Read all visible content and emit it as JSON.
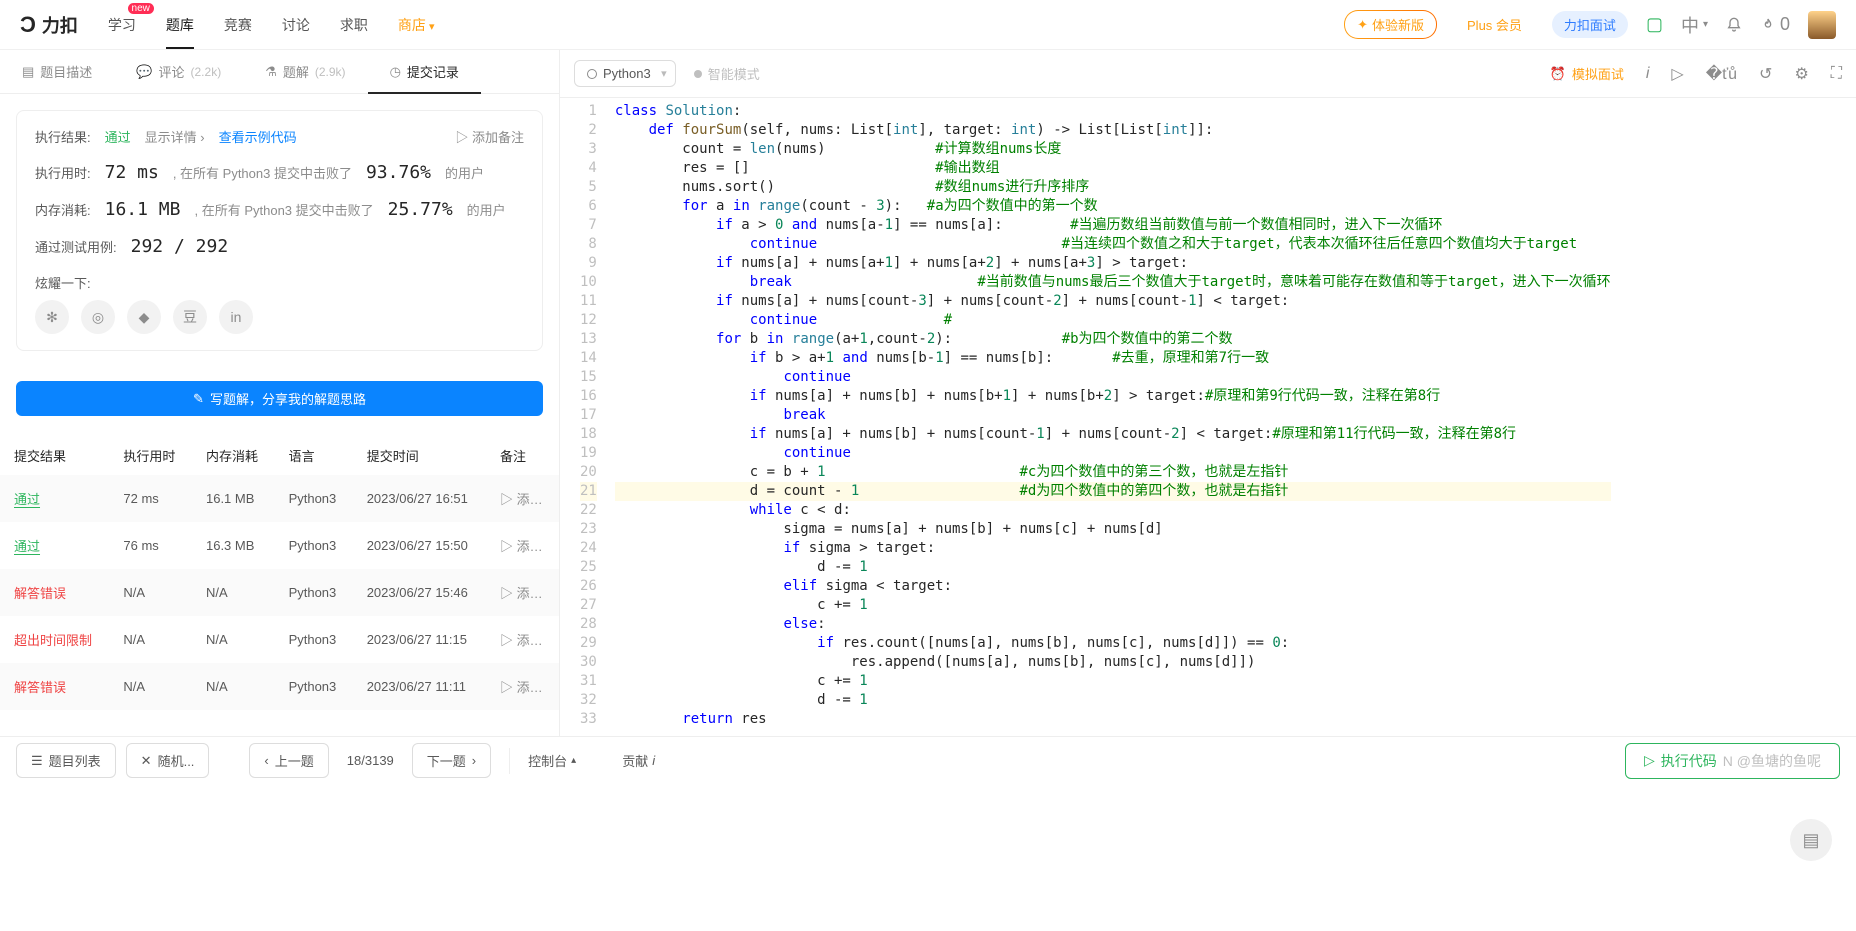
{
  "brand": "力扣",
  "nav": {
    "items": [
      {
        "label": "学习",
        "active": false,
        "highlight": false,
        "badge": "new"
      },
      {
        "label": "题库",
        "active": true
      },
      {
        "label": "竞赛"
      },
      {
        "label": "讨论"
      },
      {
        "label": "求职"
      },
      {
        "label": "商店",
        "highlight": true,
        "caret": true
      }
    ],
    "right": {
      "try_new": "体验新版",
      "plus": "Plus 会员",
      "interview": "力扣面试",
      "locale": "中",
      "fire_count": "0"
    }
  },
  "left_tabs": [
    {
      "icon": "doc",
      "label": "题目描述"
    },
    {
      "icon": "chat",
      "label": "评论",
      "count": "(2.2k)"
    },
    {
      "icon": "flask",
      "label": "题解",
      "count": "(2.9k)"
    },
    {
      "icon": "clock",
      "label": "提交记录",
      "active": true
    }
  ],
  "result": {
    "heading": "执行结果:",
    "status": "通过",
    "detail_link": "显示详情 ›",
    "example_link": "查看示例代码",
    "add_note": "添加备注",
    "time_label": "执行用时:",
    "time_value": "72 ms",
    "time_suffix_a": ", 在所有 Python3 提交中击败了",
    "time_pct": "93.76%",
    "time_suffix_b": "的用户",
    "memory_label": "内存消耗:",
    "memory_value": "16.1 MB",
    "memory_suffix_a": ", 在所有 Python3 提交中击败了",
    "memory_pct": "25.77%",
    "memory_suffix_b": "的用户",
    "tests_label": "通过测试用例:",
    "tests_value": "292 / 292",
    "brag_label": "炫耀一下:",
    "write_solution": "写题解，分享我的解题思路"
  },
  "history": {
    "headers": {
      "result": "提交结果",
      "time": "执行用时",
      "memory": "内存消耗",
      "lang": "语言",
      "submitted": "提交时间",
      "note": "备注"
    },
    "note_action": "添…",
    "rows": [
      {
        "status": "通过",
        "cls": "st-pass",
        "time": "72 ms",
        "memory": "16.1 MB",
        "lang": "Python3",
        "submitted": "2023/06/27 16:51"
      },
      {
        "status": "通过",
        "cls": "st-pass",
        "time": "76 ms",
        "memory": "16.3 MB",
        "lang": "Python3",
        "submitted": "2023/06/27 15:50"
      },
      {
        "status": "解答错误",
        "cls": "st-err",
        "time": "N/A",
        "memory": "N/A",
        "lang": "Python3",
        "submitted": "2023/06/27 15:46"
      },
      {
        "status": "超出时间限制",
        "cls": "st-err",
        "time": "N/A",
        "memory": "N/A",
        "lang": "Python3",
        "submitted": "2023/06/27 11:15"
      },
      {
        "status": "解答错误",
        "cls": "st-err",
        "time": "N/A",
        "memory": "N/A",
        "lang": "Python3",
        "submitted": "2023/06/27 11:11"
      }
    ]
  },
  "editor": {
    "language": "Python3",
    "ai_mode": "智能模式",
    "mock_label": "模拟面试",
    "code_lines": [
      {
        "n": 1,
        "segs": [
          {
            "t": "class ",
            "c": "kw"
          },
          {
            "t": "Solution",
            "c": "cls"
          },
          {
            "t": ":"
          }
        ]
      },
      {
        "n": 2,
        "segs": [
          {
            "t": "    "
          },
          {
            "t": "def ",
            "c": "kw"
          },
          {
            "t": "fourSum",
            "c": "def"
          },
          {
            "t": "(self, nums: List["
          },
          {
            "t": "int",
            "c": "builtin"
          },
          {
            "t": "], target: "
          },
          {
            "t": "int",
            "c": "builtin"
          },
          {
            "t": ") -> List[List["
          },
          {
            "t": "int",
            "c": "builtin"
          },
          {
            "t": "]]:"
          }
        ]
      },
      {
        "n": 3,
        "segs": [
          {
            "t": "        count = "
          },
          {
            "t": "len",
            "c": "builtin"
          },
          {
            "t": "(nums)             "
          },
          {
            "t": "#计算数组nums长度",
            "c": "cmt"
          }
        ]
      },
      {
        "n": 4,
        "segs": [
          {
            "t": "        res = []                      "
          },
          {
            "t": "#输出数组",
            "c": "cmt"
          }
        ]
      },
      {
        "n": 5,
        "segs": [
          {
            "t": "        nums.sort()                   "
          },
          {
            "t": "#数组nums进行升序排序",
            "c": "cmt"
          }
        ]
      },
      {
        "n": 6,
        "segs": [
          {
            "t": "        "
          },
          {
            "t": "for",
            "c": "kw"
          },
          {
            "t": " a "
          },
          {
            "t": "in",
            "c": "kw"
          },
          {
            "t": " "
          },
          {
            "t": "range",
            "c": "builtin"
          },
          {
            "t": "(count - "
          },
          {
            "t": "3",
            "c": "num"
          },
          {
            "t": "):   "
          },
          {
            "t": "#a为四个数值中的第一个数",
            "c": "cmt"
          }
        ]
      },
      {
        "n": 7,
        "segs": [
          {
            "t": "            "
          },
          {
            "t": "if",
            "c": "kw"
          },
          {
            "t": " a > "
          },
          {
            "t": "0",
            "c": "num"
          },
          {
            "t": " "
          },
          {
            "t": "and",
            "c": "kw"
          },
          {
            "t": " nums[a-"
          },
          {
            "t": "1",
            "c": "num"
          },
          {
            "t": "] == nums[a]:        "
          },
          {
            "t": "#当遍历数组当前数值与前一个数值相同时，进入下一次循环",
            "c": "cmt"
          }
        ]
      },
      {
        "n": 8,
        "segs": [
          {
            "t": "                "
          },
          {
            "t": "continue",
            "c": "kw"
          },
          {
            "t": "                             "
          },
          {
            "t": "#当连续四个数值之和大于target，代表本次循环往后任意四个数值均大于target",
            "c": "cmt"
          }
        ]
      },
      {
        "n": 9,
        "segs": [
          {
            "t": "            "
          },
          {
            "t": "if",
            "c": "kw"
          },
          {
            "t": " nums[a] + nums[a+"
          },
          {
            "t": "1",
            "c": "num"
          },
          {
            "t": "] + nums[a+"
          },
          {
            "t": "2",
            "c": "num"
          },
          {
            "t": "] + nums[a+"
          },
          {
            "t": "3",
            "c": "num"
          },
          {
            "t": "] > target:"
          }
        ]
      },
      {
        "n": 10,
        "segs": [
          {
            "t": "                "
          },
          {
            "t": "break",
            "c": "kw"
          },
          {
            "t": "                      "
          },
          {
            "t": "#当前数值与nums最后三个数值大于target时，意味着可能存在数值和等于target，进入下一次循环",
            "c": "cmt"
          }
        ]
      },
      {
        "n": 11,
        "segs": [
          {
            "t": "            "
          },
          {
            "t": "if",
            "c": "kw"
          },
          {
            "t": " nums[a] + nums[count-"
          },
          {
            "t": "3",
            "c": "num"
          },
          {
            "t": "] + nums[count-"
          },
          {
            "t": "2",
            "c": "num"
          },
          {
            "t": "] + nums[count-"
          },
          {
            "t": "1",
            "c": "num"
          },
          {
            "t": "] < target:"
          }
        ]
      },
      {
        "n": 12,
        "segs": [
          {
            "t": "                "
          },
          {
            "t": "continue",
            "c": "kw"
          },
          {
            "t": "               "
          },
          {
            "t": "#",
            "c": "cmt"
          }
        ]
      },
      {
        "n": 13,
        "segs": [
          {
            "t": "            "
          },
          {
            "t": "for",
            "c": "kw"
          },
          {
            "t": " b "
          },
          {
            "t": "in",
            "c": "kw"
          },
          {
            "t": " "
          },
          {
            "t": "range",
            "c": "builtin"
          },
          {
            "t": "(a+"
          },
          {
            "t": "1",
            "c": "num"
          },
          {
            "t": ",count-"
          },
          {
            "t": "2",
            "c": "num"
          },
          {
            "t": "):             "
          },
          {
            "t": "#b为四个数值中的第二个数",
            "c": "cmt"
          }
        ]
      },
      {
        "n": 14,
        "segs": [
          {
            "t": "                "
          },
          {
            "t": "if",
            "c": "kw"
          },
          {
            "t": " b > a+"
          },
          {
            "t": "1",
            "c": "num"
          },
          {
            "t": " "
          },
          {
            "t": "and",
            "c": "kw"
          },
          {
            "t": " nums[b-"
          },
          {
            "t": "1",
            "c": "num"
          },
          {
            "t": "] == nums[b]:       "
          },
          {
            "t": "#去重，原理和第7行一致",
            "c": "cmt"
          }
        ]
      },
      {
        "n": 15,
        "segs": [
          {
            "t": "                    "
          },
          {
            "t": "continue",
            "c": "kw"
          }
        ]
      },
      {
        "n": 16,
        "segs": [
          {
            "t": "                "
          },
          {
            "t": "if",
            "c": "kw"
          },
          {
            "t": " nums[a] + nums[b] + nums[b+"
          },
          {
            "t": "1",
            "c": "num"
          },
          {
            "t": "] + nums[b+"
          },
          {
            "t": "2",
            "c": "num"
          },
          {
            "t": "] > target:"
          },
          {
            "t": "#原理和第9行代码一致，注释在第8行",
            "c": "cmt"
          }
        ]
      },
      {
        "n": 17,
        "segs": [
          {
            "t": "                    "
          },
          {
            "t": "break",
            "c": "kw"
          }
        ]
      },
      {
        "n": 18,
        "segs": [
          {
            "t": "                "
          },
          {
            "t": "if",
            "c": "kw"
          },
          {
            "t": " nums[a] + nums[b] + nums[count-"
          },
          {
            "t": "1",
            "c": "num"
          },
          {
            "t": "] + nums[count-"
          },
          {
            "t": "2",
            "c": "num"
          },
          {
            "t": "] < target:"
          },
          {
            "t": "#原理和第11行代码一致，注释在第8行",
            "c": "cmt"
          }
        ]
      },
      {
        "n": 19,
        "segs": [
          {
            "t": "                    "
          },
          {
            "t": "continue",
            "c": "kw"
          }
        ]
      },
      {
        "n": 20,
        "segs": [
          {
            "t": "                c = b + "
          },
          {
            "t": "1",
            "c": "num"
          },
          {
            "t": "                       "
          },
          {
            "t": "#c为四个数值中的第三个数，也就是左指针",
            "c": "cmt"
          }
        ]
      },
      {
        "n": 21,
        "hl": true,
        "segs": [
          {
            "t": "                d = count - "
          },
          {
            "t": "1",
            "c": "num"
          },
          {
            "t": "                   "
          },
          {
            "t": "#d为四个数值中的第四个数，也就是右指针",
            "c": "cmt"
          }
        ]
      },
      {
        "n": 22,
        "segs": [
          {
            "t": "                "
          },
          {
            "t": "while",
            "c": "kw"
          },
          {
            "t": " c < d:"
          }
        ]
      },
      {
        "n": 23,
        "segs": [
          {
            "t": "                    sigma = nums[a] + nums[b] + nums[c] + nums[d]"
          }
        ]
      },
      {
        "n": 24,
        "segs": [
          {
            "t": "                    "
          },
          {
            "t": "if",
            "c": "kw"
          },
          {
            "t": " sigma > target:"
          }
        ]
      },
      {
        "n": 25,
        "segs": [
          {
            "t": "                        d -= "
          },
          {
            "t": "1",
            "c": "num"
          }
        ]
      },
      {
        "n": 26,
        "segs": [
          {
            "t": "                    "
          },
          {
            "t": "elif",
            "c": "kw"
          },
          {
            "t": " sigma < target:"
          }
        ]
      },
      {
        "n": 27,
        "segs": [
          {
            "t": "                        c += "
          },
          {
            "t": "1",
            "c": "num"
          }
        ]
      },
      {
        "n": 28,
        "segs": [
          {
            "t": "                    "
          },
          {
            "t": "else",
            "c": "kw"
          },
          {
            "t": ":"
          }
        ]
      },
      {
        "n": 29,
        "segs": [
          {
            "t": "                        "
          },
          {
            "t": "if",
            "c": "kw"
          },
          {
            "t": " res.count([nums[a], nums[b], nums[c], nums[d]]) == "
          },
          {
            "t": "0",
            "c": "num"
          },
          {
            "t": ":"
          }
        ]
      },
      {
        "n": 30,
        "segs": [
          {
            "t": "                            res.append([nums[a], nums[b], nums[c], nums[d]])"
          }
        ]
      },
      {
        "n": 31,
        "segs": [
          {
            "t": "                        c += "
          },
          {
            "t": "1",
            "c": "num"
          }
        ]
      },
      {
        "n": 32,
        "segs": [
          {
            "t": "                        d -= "
          },
          {
            "t": "1",
            "c": "num"
          }
        ]
      },
      {
        "n": 33,
        "segs": [
          {
            "t": "        "
          },
          {
            "t": "return",
            "c": "kw"
          },
          {
            "t": " res"
          }
        ]
      }
    ]
  },
  "bottom": {
    "problem_list": "题目列表",
    "random": "随机...",
    "prev": "上一题",
    "page": "18/3139",
    "next": "下一题",
    "console": "控制台",
    "contribute": "贡献",
    "run": "执行代码",
    "watermark": "N @鱼塘的鱼呢"
  }
}
